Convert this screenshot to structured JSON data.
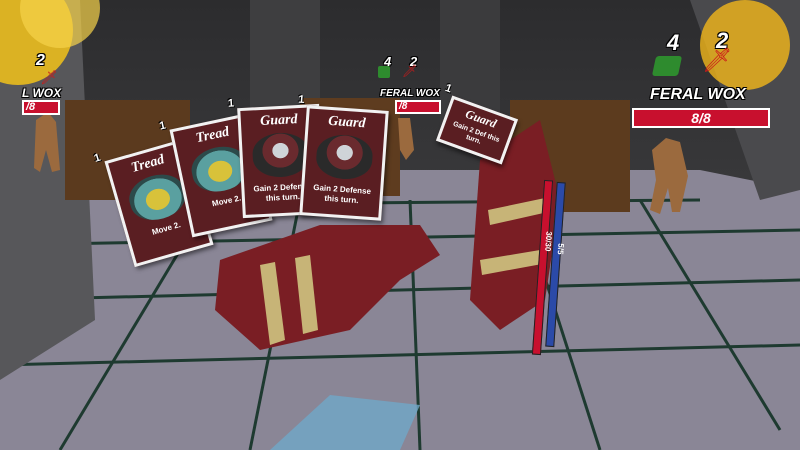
{
  "enemies": [
    {
      "name": "L WOX",
      "attack": "2",
      "health": "/8"
    },
    {
      "name": "FERAL WOX",
      "defense": "4",
      "attack": "2",
      "health": "/8"
    },
    {
      "name": "FERAL WOX",
      "defense": "4",
      "attack": "2",
      "health": "8/8"
    }
  ],
  "hand": [
    {
      "title": "Tread",
      "cost": "1",
      "text": "Move 2."
    },
    {
      "title": "Tread",
      "cost": "1",
      "text": "Move 2."
    },
    {
      "title": "Guard",
      "cost": "1",
      "text": "Gain 2 Defense this turn."
    },
    {
      "title": "Guard",
      "cost": "1",
      "text": "Gain 2 Defense this turn."
    }
  ],
  "held_card": {
    "title": "Guard",
    "cost": "1",
    "text": "Gain 2 Def this turn."
  },
  "player": {
    "health_readout": "30/30",
    "energy_readout": "5/5",
    "health_fraction": 1.0,
    "energy_fraction": 1.0
  },
  "colors": {
    "hp_red": "#c8102e",
    "defense_green": "#2e8b2e",
    "attack_red": "#cc1a1a",
    "card_border": "#f2f2f2"
  }
}
